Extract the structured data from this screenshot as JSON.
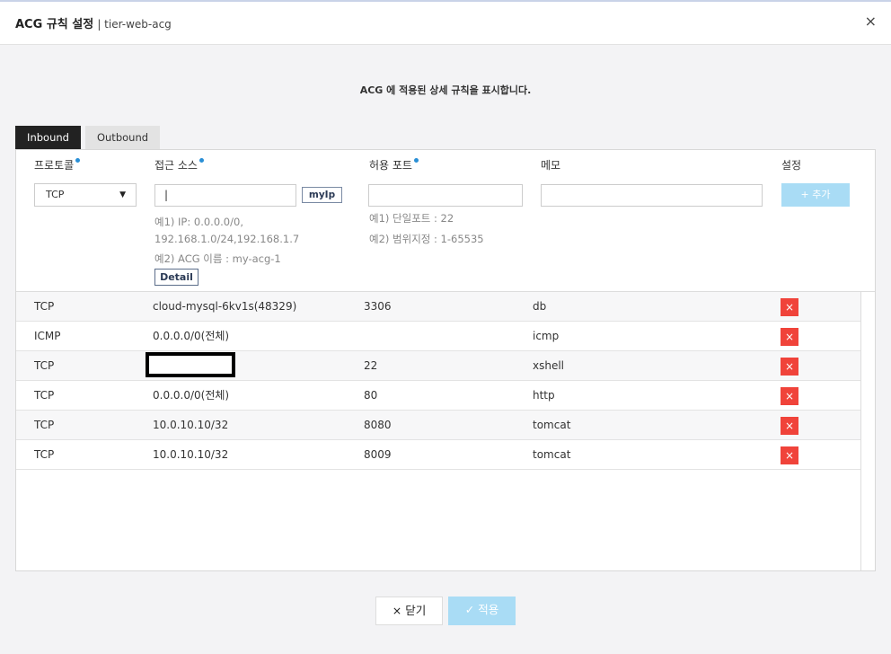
{
  "header": {
    "title": "ACG 규칙 설정",
    "subtitle": "| tier-web-acg",
    "close_icon": "×"
  },
  "description": "ACG 에 적용된 상세 규칙을 표시합니다.",
  "tabs": [
    {
      "label": "Inbound",
      "active": true
    },
    {
      "label": "Outbound",
      "active": false
    }
  ],
  "columns": {
    "protocol": "프로토콜",
    "source": "접근 소스",
    "port": "허용 포트",
    "memo": "메모",
    "settings": "설정"
  },
  "form": {
    "protocol_value": "TCP",
    "source_value": "|",
    "myip_label": "myIp",
    "source_hint1": "예1) IP: 0.0.0.0/0,",
    "source_hint1b": "192.168.1.0/24,192.168.1.7",
    "source_hint2": "예2) ACG 이름 : my-acg-1",
    "detail_label": "Detail",
    "port_hint1": "예1) 단일포트 : 22",
    "port_hint2": "예2) 범위지정 : 1-65535",
    "add_label": "+ 추가"
  },
  "rules": [
    {
      "protocol": "TCP",
      "source": "cloud-mysql-6kv1s(48329)",
      "port": "3306",
      "memo": "db"
    },
    {
      "protocol": "ICMP",
      "source": "0.0.0.0/0(전체)",
      "port": "",
      "memo": "icmp"
    },
    {
      "protocol": "TCP",
      "source": "",
      "port": "22",
      "memo": "xshell",
      "redacted": true
    },
    {
      "protocol": "TCP",
      "source": "0.0.0.0/0(전체)",
      "port": "80",
      "memo": "http"
    },
    {
      "protocol": "TCP",
      "source": "10.0.10.10/32",
      "port": "8080",
      "memo": "tomcat"
    },
    {
      "protocol": "TCP",
      "source": "10.0.10.10/32",
      "port": "8009",
      "memo": "tomcat"
    }
  ],
  "delete_icon": "×",
  "footer": {
    "close_label": "× 닫기",
    "apply_label": "✓ 적용"
  }
}
